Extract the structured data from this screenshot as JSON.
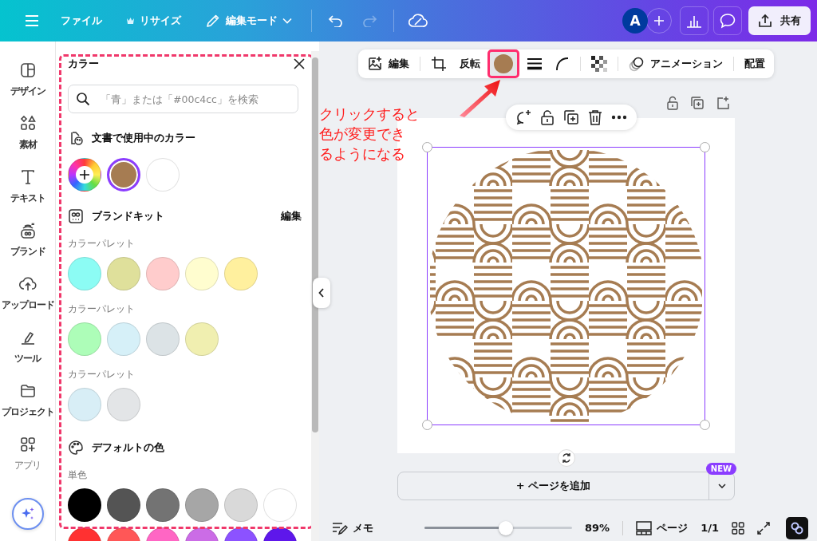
{
  "top_bar": {
    "menu": [
      {
        "kind": "file",
        "label": "ファイル"
      },
      {
        "kind": "resize",
        "label": "リサイズ"
      },
      {
        "kind": "mode",
        "label": "編集モード"
      }
    ],
    "history": [
      {
        "kind": "undo",
        "disabled": false
      },
      {
        "kind": "redo",
        "disabled": true
      }
    ],
    "avatar": "A",
    "share": "共有"
  },
  "rail": [
    {
      "kind": "design",
      "label": "デザイン"
    },
    {
      "kind": "elements",
      "label": "素材"
    },
    {
      "kind": "text",
      "label": "テキスト"
    },
    {
      "kind": "brand",
      "label": "ブランド"
    },
    {
      "kind": "uploads",
      "label": "アップロード"
    },
    {
      "kind": "tools",
      "label": "ツール"
    },
    {
      "kind": "projects",
      "label": "プロジェクト"
    },
    {
      "kind": "apps",
      "label": "アプリ"
    }
  ],
  "color_panel": {
    "title": "カラー",
    "search": {
      "placeholder": "「青」または「#00c4cc」を検索"
    },
    "document_colors": {
      "heading": "文書で使用中のカラー",
      "swatches": [
        {
          "color": "#a67c52",
          "selected": true
        },
        {
          "color": "#ffffff",
          "selected": false
        }
      ]
    },
    "brand_kit": {
      "heading": "ブランドキット",
      "edit": "編集",
      "palettes": [
        {
          "label": "カラーパレット",
          "swatches": [
            {
              "color": "#8cfcf4"
            },
            {
              "color": "#dfe09b"
            },
            {
              "color": "#ffcccc"
            },
            {
              "color": "#fffdcf"
            },
            {
              "color": "#fff09e"
            }
          ]
        },
        {
          "label": "カラーパレット",
          "swatches": [
            {
              "color": "#adfdb8"
            },
            {
              "color": "#d6f0f8"
            },
            {
              "color": "#dce3e6"
            },
            {
              "color": "#f0efb0"
            }
          ]
        },
        {
          "label": "カラーパレット",
          "swatches": [
            {
              "color": "#d8eef6"
            },
            {
              "color": "#e3e5e7"
            }
          ]
        }
      ]
    },
    "default_colors": {
      "heading": "デフォルトの色",
      "groups": [
        {
          "label": "単色",
          "swatches": [
            {
              "color": "#000000"
            },
            {
              "color": "#545454"
            },
            {
              "color": "#737373"
            },
            {
              "color": "#a6a6a6"
            },
            {
              "color": "#d9d9d9"
            },
            {
              "color": "#ffffff"
            },
            {
              "color": "#ff3131"
            },
            {
              "color": "#ff5757"
            },
            {
              "color": "#ff66c4"
            },
            {
              "color": "#cb6ce6"
            },
            {
              "color": "#8c52ff"
            },
            {
              "color": "#5e17eb"
            }
          ]
        }
      ]
    }
  },
  "context_toolbar": {
    "groups": [
      {
        "items": [
          {
            "kind": "edit",
            "label": "編集"
          }
        ]
      },
      {
        "items": [
          {
            "kind": "crop"
          },
          {
            "kind": "flip",
            "label": "反転"
          },
          {
            "kind": "color",
            "color": "#a67c52",
            "selected": true
          },
          {
            "kind": "border"
          },
          {
            "kind": "corner"
          }
        ]
      },
      {
        "items": [
          {
            "kind": "transparency"
          }
        ]
      },
      {
        "items": [
          {
            "kind": "animate",
            "label": "アニメーション"
          }
        ]
      },
      {
        "items": [
          {
            "kind": "position",
            "label": "配置"
          }
        ]
      }
    ]
  },
  "annotation": {
    "lines": [
      "クリックすると",
      "色が変更でき",
      "るようになる"
    ]
  },
  "canvas": {
    "add_page": "+ ページを追加",
    "badge": "NEW"
  },
  "footer": {
    "notes": "メモ",
    "zoom": {
      "level": 0.55,
      "reading": "89%"
    },
    "pages": "ページ",
    "page_count": "1/1"
  }
}
